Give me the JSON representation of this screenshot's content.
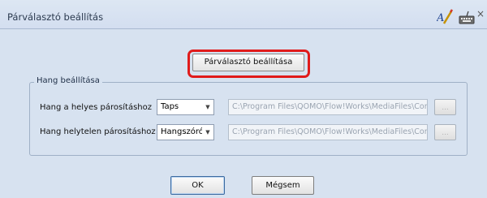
{
  "window": {
    "title": "Párválasztó beállítás",
    "close_glyph": "×",
    "icons": [
      "edit-text-icon",
      "keyboard-icon"
    ]
  },
  "setup_button": {
    "label": "Párválasztó beállítása"
  },
  "sound_group": {
    "title": "Hang beállítása",
    "rows": [
      {
        "label": "Hang a helyes párosításhoz",
        "selected": "Taps",
        "path": "C:\\Program Files\\QOMO\\Flow!Works\\MediaFiles\\Cor",
        "browse": "..."
      },
      {
        "label": "Hang helytelen párosításhoz",
        "selected": "Hangszóró",
        "path": "C:\\Program Files\\QOMO\\Flow!Works\\MediaFiles\\Cor",
        "browse": "..."
      }
    ]
  },
  "footer": {
    "ok_label": "OK",
    "cancel_label": "Mégsem"
  },
  "colors": {
    "highlight": "#e01b1b",
    "dialog_bg": "#d7e2f0"
  }
}
